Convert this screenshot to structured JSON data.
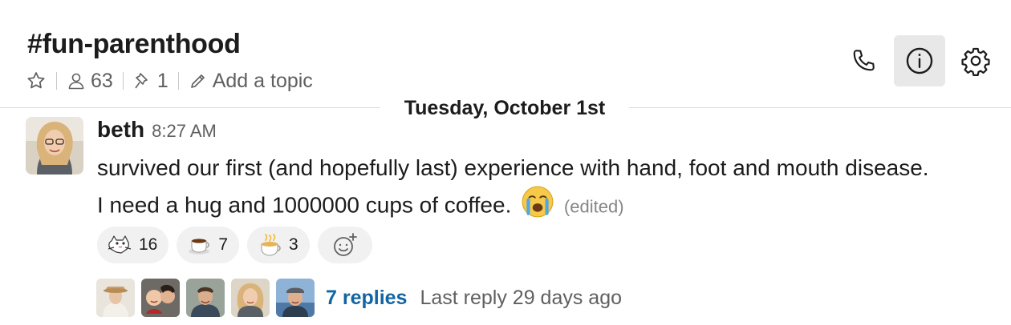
{
  "channel": {
    "name": "#fun-parenthood",
    "member_count": "63",
    "pinned_count": "1",
    "topic_placeholder": "Add a topic"
  },
  "header_icons": [
    "phone-icon",
    "info-icon",
    "gear-icon"
  ],
  "date_divider": "Tuesday, October 1st",
  "message": {
    "author": "beth",
    "time": "8:27 AM",
    "line1": "survived our first (and hopefully last) experience with hand, foot and mouth disease.",
    "line2": "I need a hug and 1000000 cups of coffee.",
    "edited": "(edited)",
    "inline_emoji": "crying-face-emoji"
  },
  "reactions": [
    {
      "icon": "hug-cat-emoji",
      "count": "16"
    },
    {
      "icon": "coffee-emoji",
      "count": "7"
    },
    {
      "icon": "hot-coffee-cup-emoji",
      "count": "3"
    }
  ],
  "thread": {
    "replies": "7 replies",
    "last_reply": "Last reply 29 days ago"
  },
  "colors": {
    "link": "#1264a3",
    "muted": "#616061",
    "reaction_bg": "#f1f1f1",
    "active_icon_bg": "#e8e8e8"
  }
}
